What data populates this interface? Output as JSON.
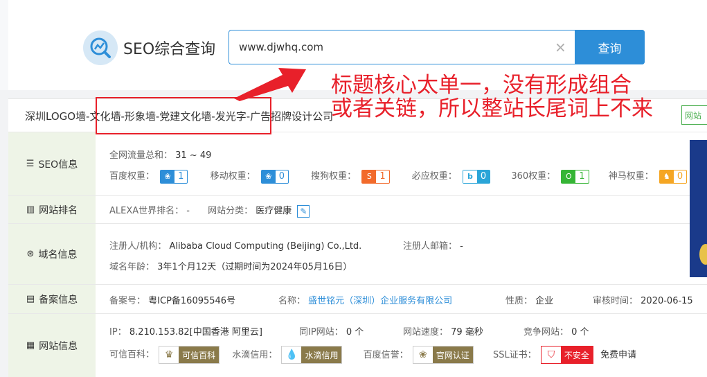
{
  "logo": {
    "text": "SEO综合查询"
  },
  "search": {
    "value": "www.djwhq.com",
    "clear": "×",
    "button": "查询"
  },
  "annotation": {
    "line1": "标题核心太单一，没有形成组合",
    "line2": "或者关链，所以整站长尾词上不来"
  },
  "site_title": "深圳LOGO墙-文化墙-形象墙-党建文化墙-发光字-广告招牌设计公司",
  "site_tag": "网站",
  "seo": {
    "label": "SEO信息",
    "traffic_label": "全网流量总和：",
    "traffic_value": "31 ~ 49",
    "weights": [
      {
        "label": "百度权重：",
        "value": "1",
        "color": "#2d8ed8",
        "icon": "paw-icon"
      },
      {
        "label": "移动权重：",
        "value": "0",
        "color": "#2d8ed8",
        "icon": "paw-icon"
      },
      {
        "label": "搜狗权重：",
        "value": "1",
        "color": "#f26a2b",
        "icon": "sogou-icon"
      },
      {
        "label": "必应权重：",
        "value": "0",
        "color": "#2aa5d8",
        "icon": "bing-icon"
      },
      {
        "label": "360权重：",
        "value": "1",
        "color": "#35b535",
        "icon": "360-icon"
      },
      {
        "label": "神马权重：",
        "value": "0",
        "color": "#f5a623",
        "icon": "shenma-icon"
      }
    ]
  },
  "rank": {
    "label": "网站排名",
    "alexa_label": "ALEXA世界排名：",
    "alexa_value": "-",
    "category_label": "网站分类：",
    "category_value": "医疗健康"
  },
  "domain": {
    "label": "域名信息",
    "registrant_label": "注册人/机构：",
    "registrant_value": "Alibaba Cloud Computing (Beijing) Co.,Ltd.",
    "email_label": "注册人邮箱：",
    "email_value": "-",
    "age_label": "域名年龄：",
    "age_value": "3年1个月12天（过期时间为2024年05月16日）"
  },
  "icp": {
    "label": "备案信息",
    "no_label": "备案号：",
    "no_value": "粤ICP备16095546号",
    "name_label": "名称：",
    "name_value": "盛世铭元（深圳）企业服务有限公司",
    "nature_label": "性质：",
    "nature_value": "企业",
    "date_label": "审核时间：",
    "date_value": "2020-06-15"
  },
  "site": {
    "label": "网站信息",
    "ip_label": "IP：",
    "ip_value": "8.210.153.82[中国香港 阿里云]",
    "sameip_label": "同IP网站：",
    "sameip_value": "0 个",
    "speed_label": "网站速度：",
    "speed_value": "79 毫秒",
    "compete_label": "竞争网站：",
    "compete_value": "0 个",
    "kexin_label": "可信百科：",
    "kexin_tag": "可信百科",
    "shuidi_label": "水滴信用：",
    "shuidi_tag": "水滴信用",
    "baidu_label": "百度信誉：",
    "baidu_tag": "官网认证",
    "ssl_label": "SSL证书：",
    "ssl_tag": "不安全",
    "ssl_free": "免费申请"
  }
}
